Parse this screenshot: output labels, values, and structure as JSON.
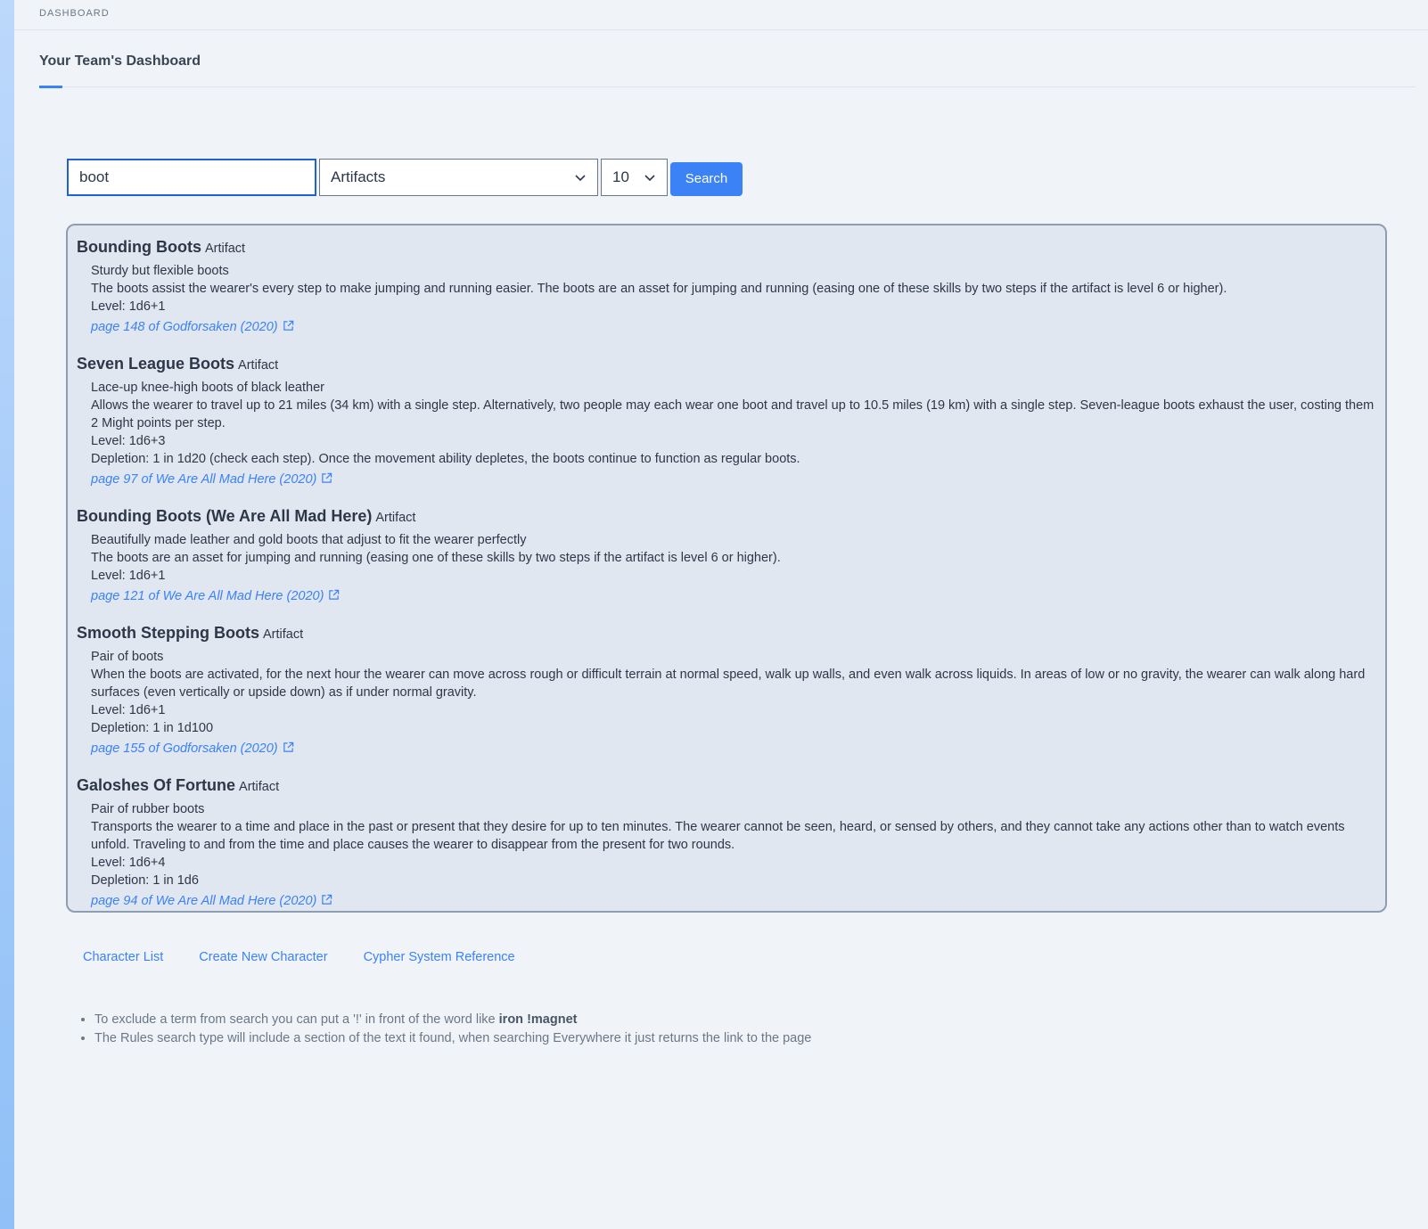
{
  "breadcrumb": "DASHBOARD",
  "page_title": "Your Team's Dashboard",
  "search": {
    "query": "boot",
    "category": "Artifacts",
    "limit": "10",
    "button_label": "Search"
  },
  "results": [
    {
      "name": "Bounding Boots",
      "type": "Artifact",
      "lines": [
        "Sturdy but flexible boots",
        "The boots assist the wearer's every step to make jumping and running easier. The boots are an asset for jumping and running (easing one of these skills by two steps if the artifact is level 6 or higher).",
        "Level: 1d6+1"
      ],
      "source": "page 148 of Godforsaken (2020)"
    },
    {
      "name": "Seven League Boots",
      "type": "Artifact",
      "lines": [
        "Lace-up knee-high boots of black leather",
        "Allows the wearer to travel up to 21 miles (34 km) with a single step. Alternatively, two people may each wear one boot and travel up to 10.5 miles (19 km) with a single step. Seven-league boots exhaust the user, costing them 2 Might points per step.",
        "Level: 1d6+3",
        "Depletion: 1 in 1d20 (check each step). Once the movement ability depletes, the boots continue to function as regular boots."
      ],
      "source": "page 97 of We Are All Mad Here (2020)"
    },
    {
      "name": "Bounding Boots (We Are All Mad Here)",
      "type": "Artifact",
      "lines": [
        "Beautifully made leather and gold boots that adjust to fit the wearer perfectly",
        "The boots are an asset for jumping and running (easing one of these skills by two steps if the artifact is level 6 or higher).",
        "Level: 1d6+1"
      ],
      "source": "page 121 of We Are All Mad Here (2020)"
    },
    {
      "name": "Smooth Stepping Boots",
      "type": "Artifact",
      "lines": [
        "Pair of boots",
        "When the boots are activated, for the next hour the wearer can move across rough or difficult terrain at normal speed, walk up walls, and even walk across liquids. In areas of low or no gravity, the wearer can walk along hard surfaces (even vertically or upside down) as if under normal gravity.",
        "Level: 1d6+1",
        "Depletion: 1 in 1d100"
      ],
      "source": "page 155 of Godforsaken (2020)"
    },
    {
      "name": "Galoshes Of Fortune",
      "type": "Artifact",
      "lines": [
        "Pair of rubber boots",
        "Transports the wearer to a time and place in the past or present that they desire for up to ten minutes. The wearer cannot be seen, heard, or sensed by others, and they cannot take any actions other than to watch events unfold. Traveling to and from the time and place causes the wearer to disappear from the present for two rounds.",
        "Level: 1d6+4",
        "Depletion: 1 in 1d6"
      ],
      "source": "page 94 of We Are All Mad Here (2020)"
    }
  ],
  "footer_links": [
    "Character List",
    "Create New Character",
    "Cypher System Reference"
  ],
  "tips": {
    "tip1_text": "To exclude a term from search you can put a '!' in front of the word like ",
    "tip1_example": "iron !magnet",
    "tip2_text": "The Rules search type will include a section of the text it found, when searching Everywhere it just returns the link to the page"
  },
  "colors": {
    "accent": "#3b82f6",
    "background": "#f0f4f9",
    "results_panel": "#e0e7f0"
  }
}
